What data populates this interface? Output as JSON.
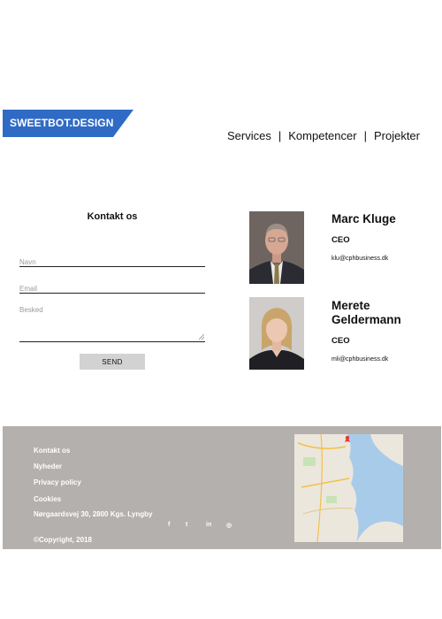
{
  "header": {
    "logo_text": "SWEETBOT.DESIGN",
    "nav": [
      "Services",
      "Kompetencer",
      "Projekter"
    ],
    "nav_separator": "|"
  },
  "contact_form": {
    "title": "Kontakt os",
    "fields": {
      "navn_placeholder": "Navn",
      "email_placeholder": "Email",
      "besked_placeholder": "Besked"
    },
    "send_label": "SEND"
  },
  "contacts": [
    {
      "name": "Marc Kluge",
      "role": "CEO",
      "email": "klu@cphbusiness.dk"
    },
    {
      "name": "Merete Geldermann",
      "role": "CEO",
      "email": "mli@cphbusiness.dk"
    }
  ],
  "footer": {
    "links": [
      "Kontakt os",
      "Nyheder",
      "Privacy policy",
      "Cookies"
    ],
    "address": "Nørgaardsvej 30, 2800 Kgs. Lyngby",
    "copyright": "©Copyright, 2018",
    "social": [
      {
        "icon": "facebook-icon",
        "glyph": "f"
      },
      {
        "icon": "twitter-icon",
        "glyph": "t"
      },
      {
        "icon": "linkedin-icon",
        "glyph": "in"
      },
      {
        "icon": "instagram-icon",
        "glyph": "◎"
      }
    ]
  },
  "colors": {
    "logo_bg": "#2f6bc5",
    "footer_bg": "#b4b0ad",
    "button_bg": "#d2d2d2",
    "map_water": "#a8cbe9",
    "map_land": "#ece7dc"
  }
}
